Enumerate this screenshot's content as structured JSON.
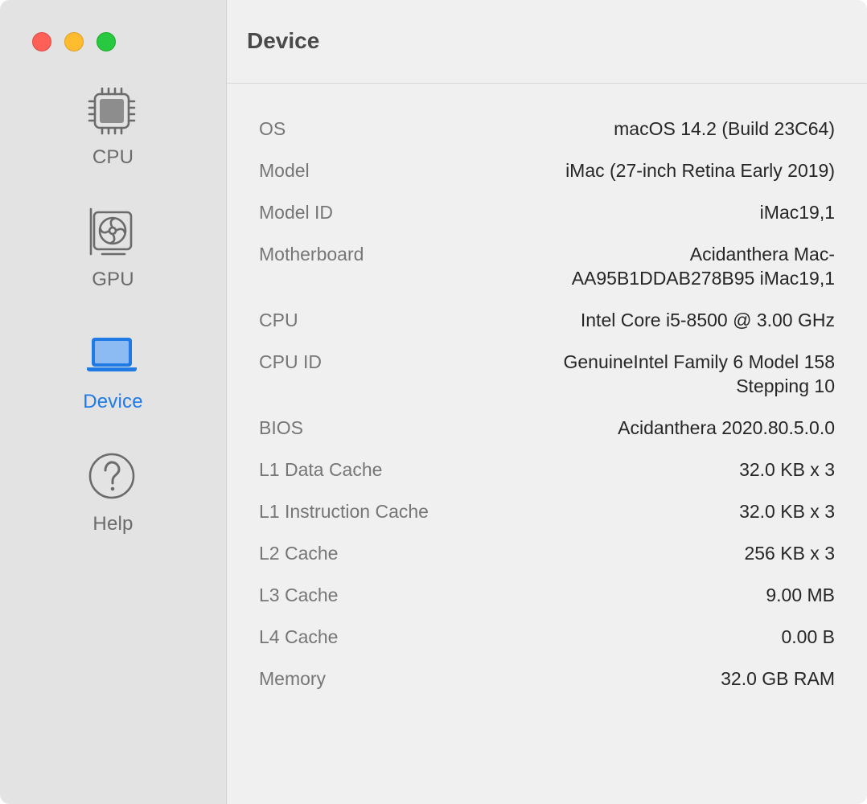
{
  "sidebar": {
    "items": [
      {
        "label": "CPU",
        "icon": "cpu-icon"
      },
      {
        "label": "GPU",
        "icon": "gpu-icon"
      },
      {
        "label": "Device",
        "icon": "laptop-icon",
        "active": true
      },
      {
        "label": "Help",
        "icon": "help-icon"
      }
    ]
  },
  "colors": {
    "accent": "#1f7ae5",
    "close": "#fe5f57",
    "minimize": "#febc2e",
    "maximize": "#28c840"
  },
  "header": {
    "title": "Device"
  },
  "info": {
    "rows": [
      {
        "label": "OS",
        "value": "macOS 14.2 (Build 23C64)"
      },
      {
        "label": "Model",
        "value": "iMac (27-inch Retina Early 2019)"
      },
      {
        "label": "Model ID",
        "value": "iMac19,1"
      },
      {
        "label": "Motherboard",
        "value": "Acidanthera Mac-AA95B1DDAB278B95 iMac19,1"
      },
      {
        "label": "CPU",
        "value": "Intel Core i5-8500 @ 3.00 GHz"
      },
      {
        "label": "CPU ID",
        "value": "GenuineIntel Family 6 Model 158 Stepping 10"
      },
      {
        "label": "BIOS",
        "value": "Acidanthera 2020.80.5.0.0"
      },
      {
        "label": "L1 Data Cache",
        "value": "32.0 KB x 3"
      },
      {
        "label": "L1 Instruction Cache",
        "value": "32.0 KB x 3"
      },
      {
        "label": "L2 Cache",
        "value": "256 KB x 3"
      },
      {
        "label": "L3 Cache",
        "value": "9.00 MB"
      },
      {
        "label": "L4 Cache",
        "value": "0.00 B"
      },
      {
        "label": "Memory",
        "value": "32.0 GB RAM"
      }
    ]
  }
}
